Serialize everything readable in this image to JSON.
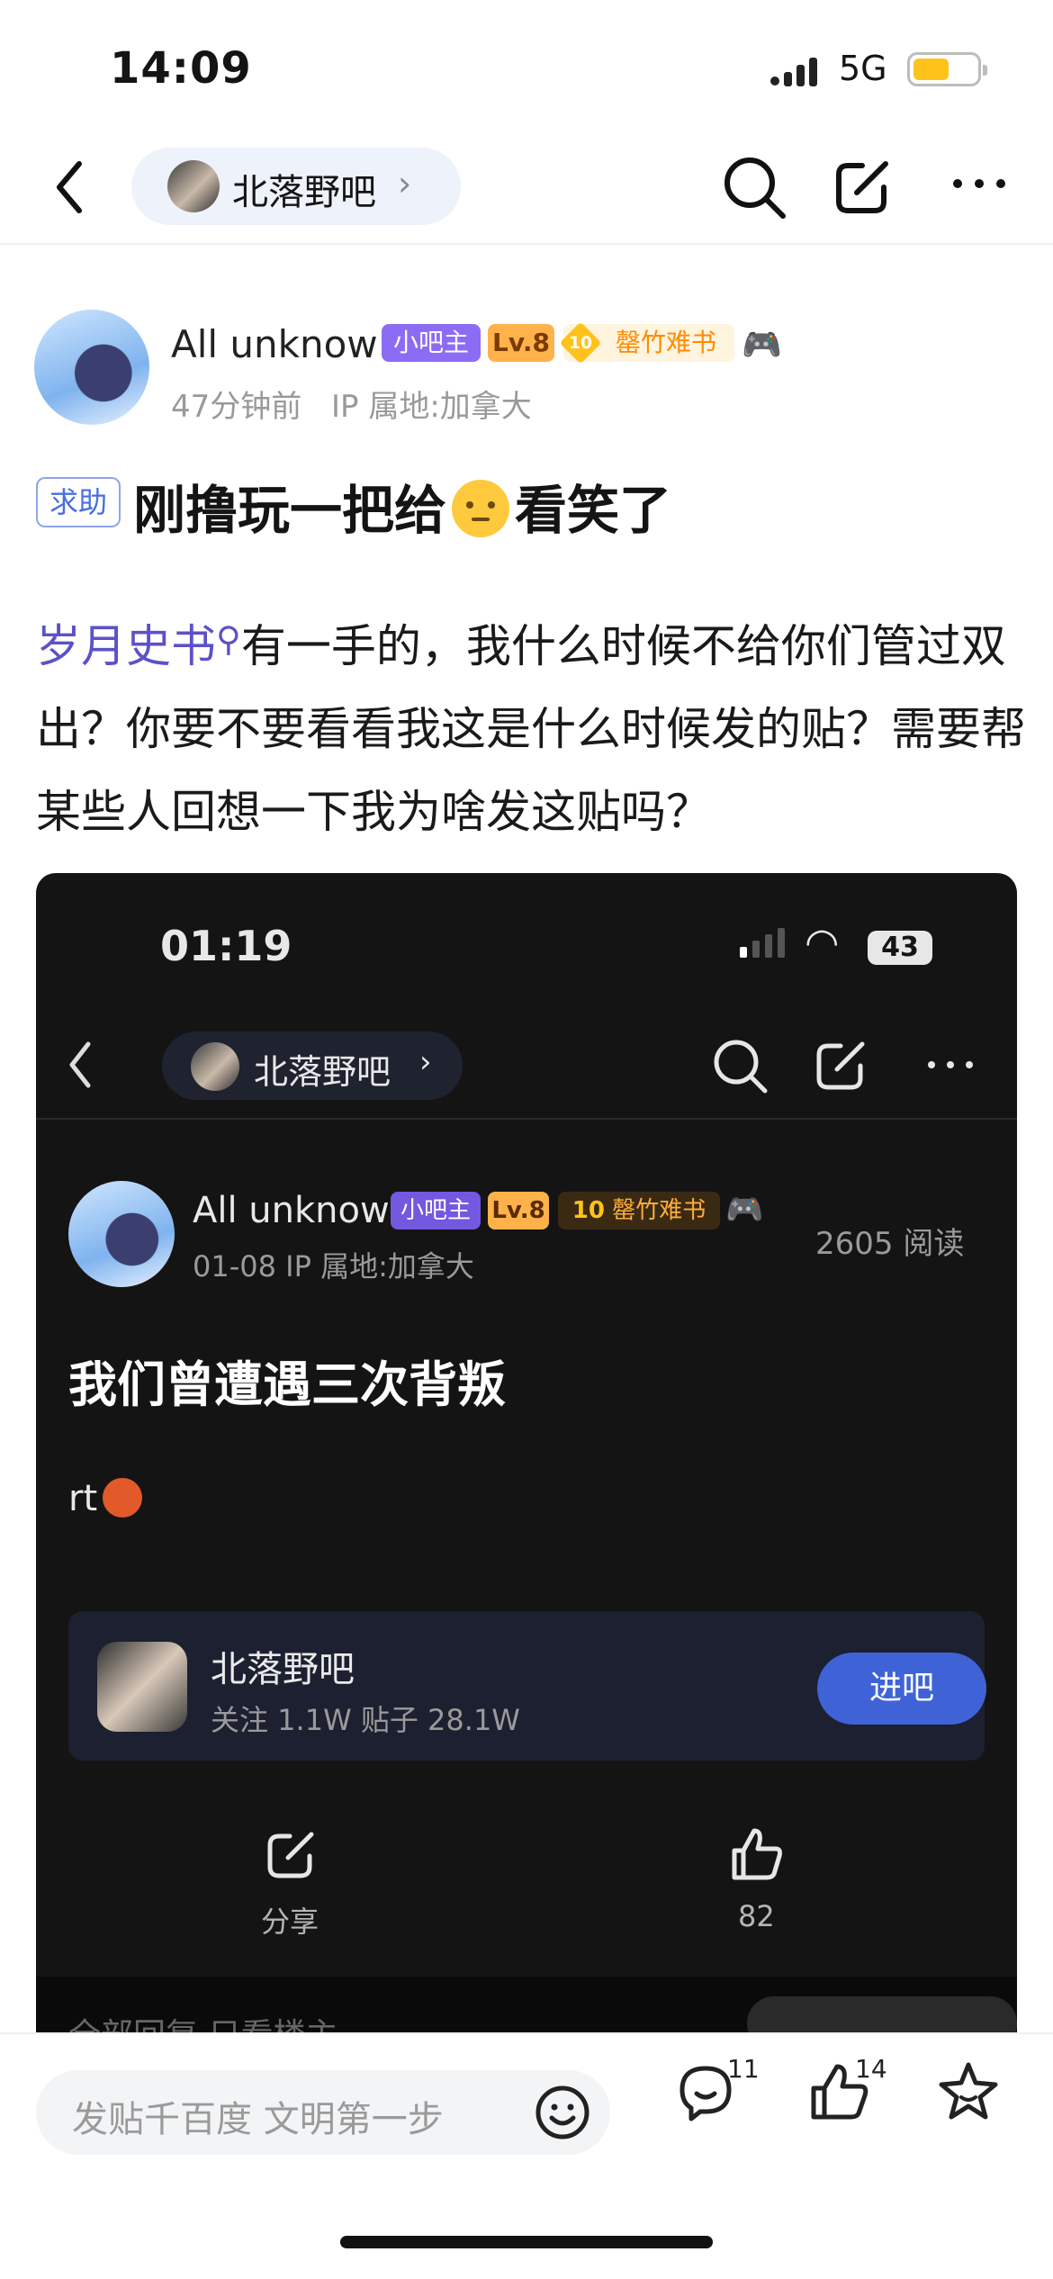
{
  "status_bar": {
    "time": "14:09",
    "network": "5G",
    "battery_level": 0.55
  },
  "nav": {
    "forum_name": "北落野吧",
    "back_icon": "chevron-left-icon",
    "search_icon": "search-icon",
    "share_icon": "share-icon",
    "more_icon": "more-icon"
  },
  "author": {
    "name": "All unknow",
    "role_badge": "小吧主",
    "level": "Lv.8",
    "title_level": "10",
    "title": "罄竹难书",
    "time_ago": "47分钟前",
    "ip": "IP 属地:加拿大"
  },
  "post": {
    "tag": "求助",
    "title_a": "刚撸玩一把给",
    "title_b": "看笑了",
    "mention": "岁月史书",
    "body": "有一手的，我什么时候不给你们管过双出？你要不要看看我这是什么时候发的贴？需要帮某些人回想一下我为啥发这贴吗？"
  },
  "embed": {
    "time": "01:19",
    "battery": "43",
    "forum_name": "北落野吧",
    "author_name": "All unknow",
    "role_badge": "小吧主",
    "level": "Lv.8",
    "title_level": "10",
    "title": "罄竹难书",
    "meta": "01-08   IP 属地:加拿大",
    "reads": "2605 阅读",
    "post_title": "我们曾遭遇三次背叛",
    "post_body": "rt",
    "card_name": "北落野吧",
    "card_stats": "关注 1.1W   贴子 28.1W",
    "enter_label": "进吧",
    "share_label": "分享",
    "like_count": "82",
    "cut_text": "全部回复    只看楼主"
  },
  "bottom_bar": {
    "placeholder": "发贴千百度 文明第一步",
    "comments_count": "11",
    "likes_count": "14"
  }
}
